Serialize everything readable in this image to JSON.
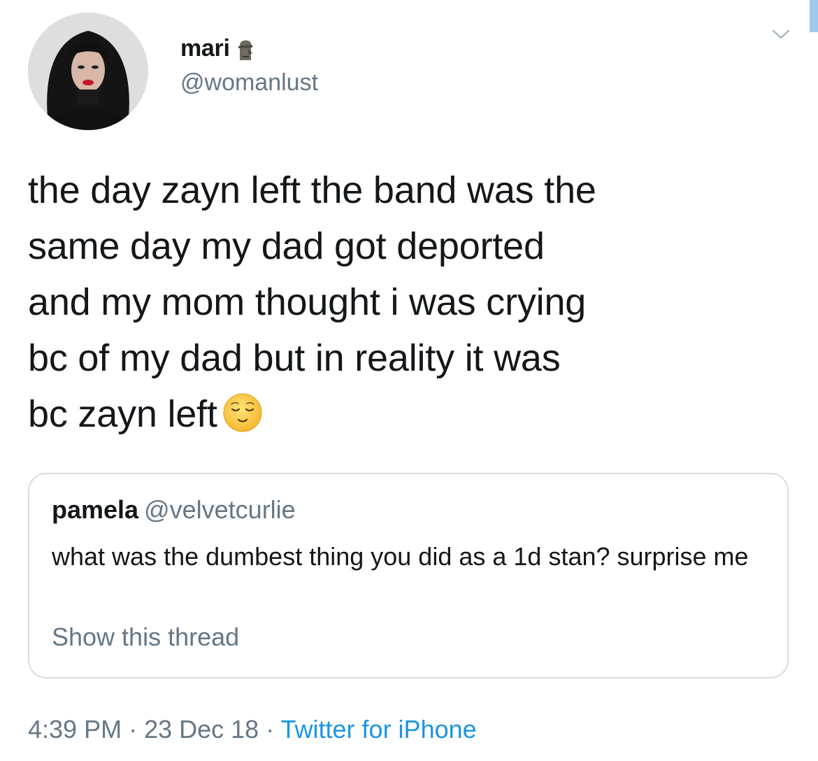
{
  "author": {
    "display_name": "mari",
    "handle": "@womanlust",
    "name_badge_icon": "moai-icon"
  },
  "tweet": {
    "text": "the day zayn left the band was the\nsame day my dad got deported\nand my mom thought i was crying\nbc of my dad but in reality it was\nbc zayn left",
    "emoji": "relieved-face-emoji"
  },
  "quoted_tweet": {
    "display_name": "pamela",
    "handle": "@velvetcurlie",
    "text": "what was the dumbest thing you did as a 1d stan? surprise me",
    "show_thread_label": "Show this thread"
  },
  "meta": {
    "time": "4:39 PM",
    "separator": " · ",
    "date": "23 Dec 18",
    "source": "Twitter for iPhone"
  },
  "colors": {
    "link_blue": "#1b95e0",
    "secondary_gray": "#657786",
    "border_gray": "#d6dde3"
  }
}
